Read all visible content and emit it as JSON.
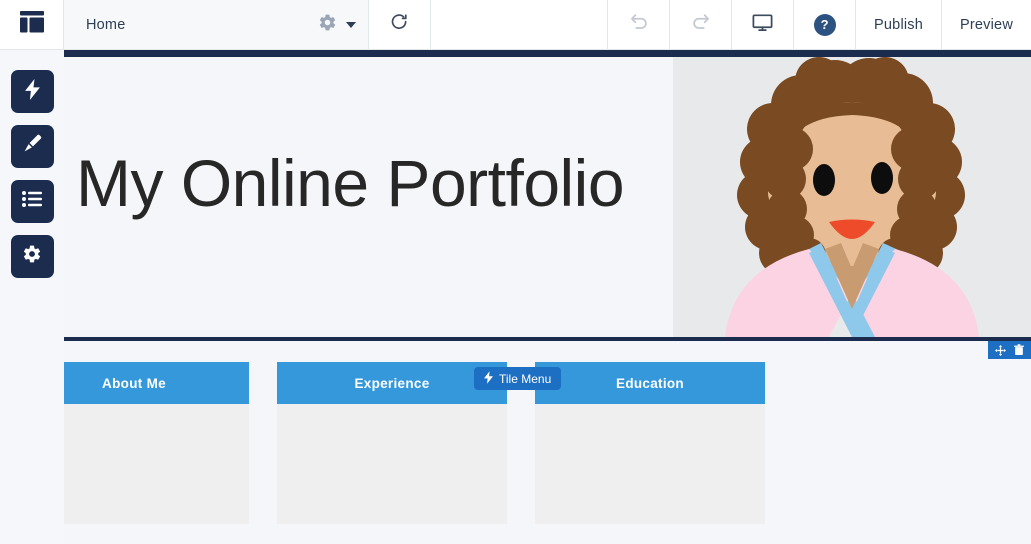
{
  "toolbar": {
    "logo_icon": "layout-template-icon",
    "page_name": "Home",
    "gear_icon": "gear-icon",
    "caret_icon": "chevron-down-icon",
    "refresh_icon": "refresh-icon",
    "undo_icon": "undo-icon",
    "redo_icon": "redo-icon",
    "device_icon": "desktop-monitor-icon",
    "help_icon": "help-question-icon",
    "help_glyph": "?",
    "publish_label": "Publish",
    "preview_label": "Preview"
  },
  "sidebar": {
    "items": [
      {
        "name": "sidebar-item-elements",
        "icon": "lightning-bolt-icon"
      },
      {
        "name": "sidebar-item-design",
        "icon": "paintbrush-icon"
      },
      {
        "name": "sidebar-item-pages",
        "icon": "list-icon"
      },
      {
        "name": "sidebar-item-settings",
        "icon": "gear-icon"
      }
    ]
  },
  "canvas": {
    "hero": {
      "title": "My Online Portfolio",
      "image_alt": "woman-avatar-illustration",
      "colors": {
        "hair": "#7a4a22",
        "skin": "#e8bc95",
        "neck": "#c99b71",
        "eye": "#0d0d0d",
        "lips": "#ee4b2b",
        "collar": "#8ec8ea",
        "blouse": "#fbd3e3",
        "panel_bg": "#e8e9ea"
      }
    },
    "tile_badge": {
      "label": "Tile Menu",
      "icon": "lightning-bolt-icon",
      "color": "#1d6fc4"
    },
    "section_tools": [
      {
        "name": "move-section-handle",
        "icon": "move-arrows-icon"
      },
      {
        "name": "delete-section-button",
        "icon": "trash-icon"
      }
    ],
    "tiles": [
      {
        "label": "About Me"
      },
      {
        "label": "Experience"
      },
      {
        "label": "Education"
      }
    ],
    "accent": "#3498db",
    "navy": "#1b2c4f"
  }
}
